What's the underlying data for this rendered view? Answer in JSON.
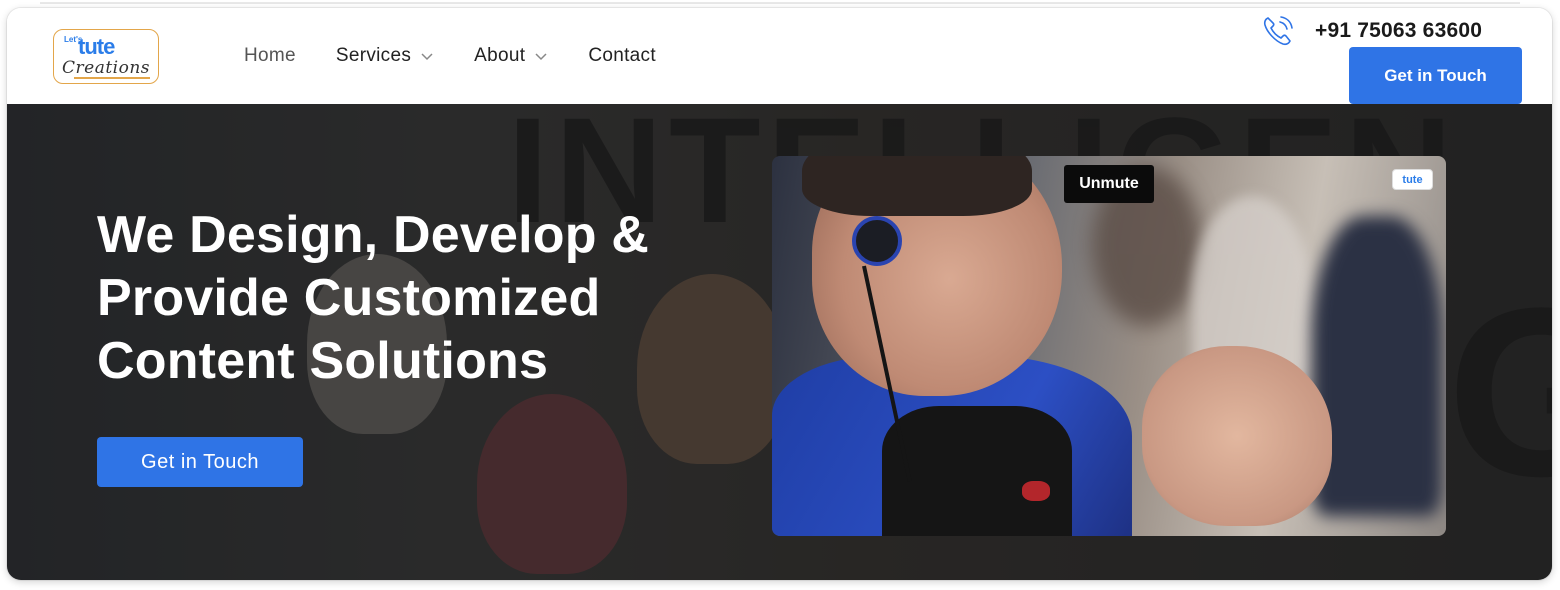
{
  "logo": {
    "lets": "Let's",
    "tute": "tute",
    "creations": "Creations"
  },
  "nav": {
    "items": [
      {
        "label": "Home"
      },
      {
        "label": "Services"
      },
      {
        "label": "About"
      },
      {
        "label": "Contact"
      }
    ]
  },
  "contact": {
    "phone": "+91 75063 63600",
    "cta_label": "Get in Touch"
  },
  "hero": {
    "headline": [
      "We Design, Develop &",
      "Provide Customized",
      "Content Solutions"
    ],
    "cta_label": "Get in Touch"
  },
  "video": {
    "unmute_label": "Unmute",
    "badge": "tute"
  },
  "colors": {
    "accent": "#2f74e6",
    "logo_border": "#e3a64a",
    "brand_blue": "#2b7de9"
  },
  "icons": [
    "phone-icon",
    "chevron-down-icon"
  ]
}
